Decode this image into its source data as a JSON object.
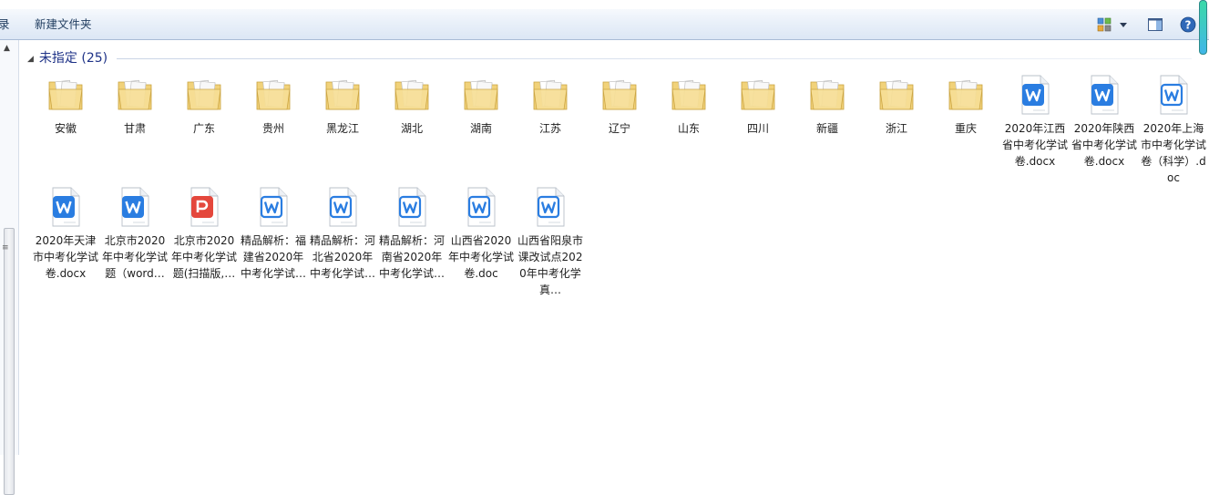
{
  "toolbar": {
    "left_cut_label": "录",
    "new_folder_label": "新建文件夹",
    "view_icon": "view-options-icon",
    "preview_icon": "preview-pane-icon",
    "help_icon": "help-icon"
  },
  "group": {
    "title": "未指定 (25)"
  },
  "folders": [
    {
      "label": "安徽"
    },
    {
      "label": "甘肃"
    },
    {
      "label": "广东"
    },
    {
      "label": "贵州"
    },
    {
      "label": "黑龙江"
    },
    {
      "label": "湖北"
    },
    {
      "label": "湖南"
    },
    {
      "label": "江苏"
    },
    {
      "label": "辽宁"
    },
    {
      "label": "山东"
    },
    {
      "label": "四川"
    },
    {
      "label": "新疆"
    },
    {
      "label": "浙江"
    },
    {
      "label": "重庆"
    }
  ],
  "files_row1": [
    {
      "label": "2020年江西省中考化学试卷.docx",
      "type": "word"
    },
    {
      "label": "2020年陕西省中考化学试卷.docx",
      "type": "word"
    },
    {
      "label": "2020年上海市中考化学试卷（科学）.doc",
      "type": "word-outline"
    }
  ],
  "files_row2": [
    {
      "label": "2020年天津市中考化学试卷.docx",
      "type": "word"
    },
    {
      "label": "北京市2020年中考化学试题（word…",
      "type": "word"
    },
    {
      "label": "北京市2020年中考化学试题(扫描版,…",
      "type": "pdf"
    },
    {
      "label": "精品解析：福建省2020年中考化学试…",
      "type": "word-outline"
    },
    {
      "label": "精品解析：河北省2020年中考化学试…",
      "type": "word-outline"
    },
    {
      "label": "精品解析：河南省2020年中考化学试…",
      "type": "word-outline"
    },
    {
      "label": "山西省2020年中考化学试卷.doc",
      "type": "word-outline"
    },
    {
      "label": "山西省阳泉市课改试点2020年中考化学真…",
      "type": "word-outline"
    }
  ],
  "colors": {
    "folder": "#f1d27a",
    "word_blue": "#2a7de1",
    "pdf_red": "#e4473c",
    "group_text": "#1e3287"
  }
}
